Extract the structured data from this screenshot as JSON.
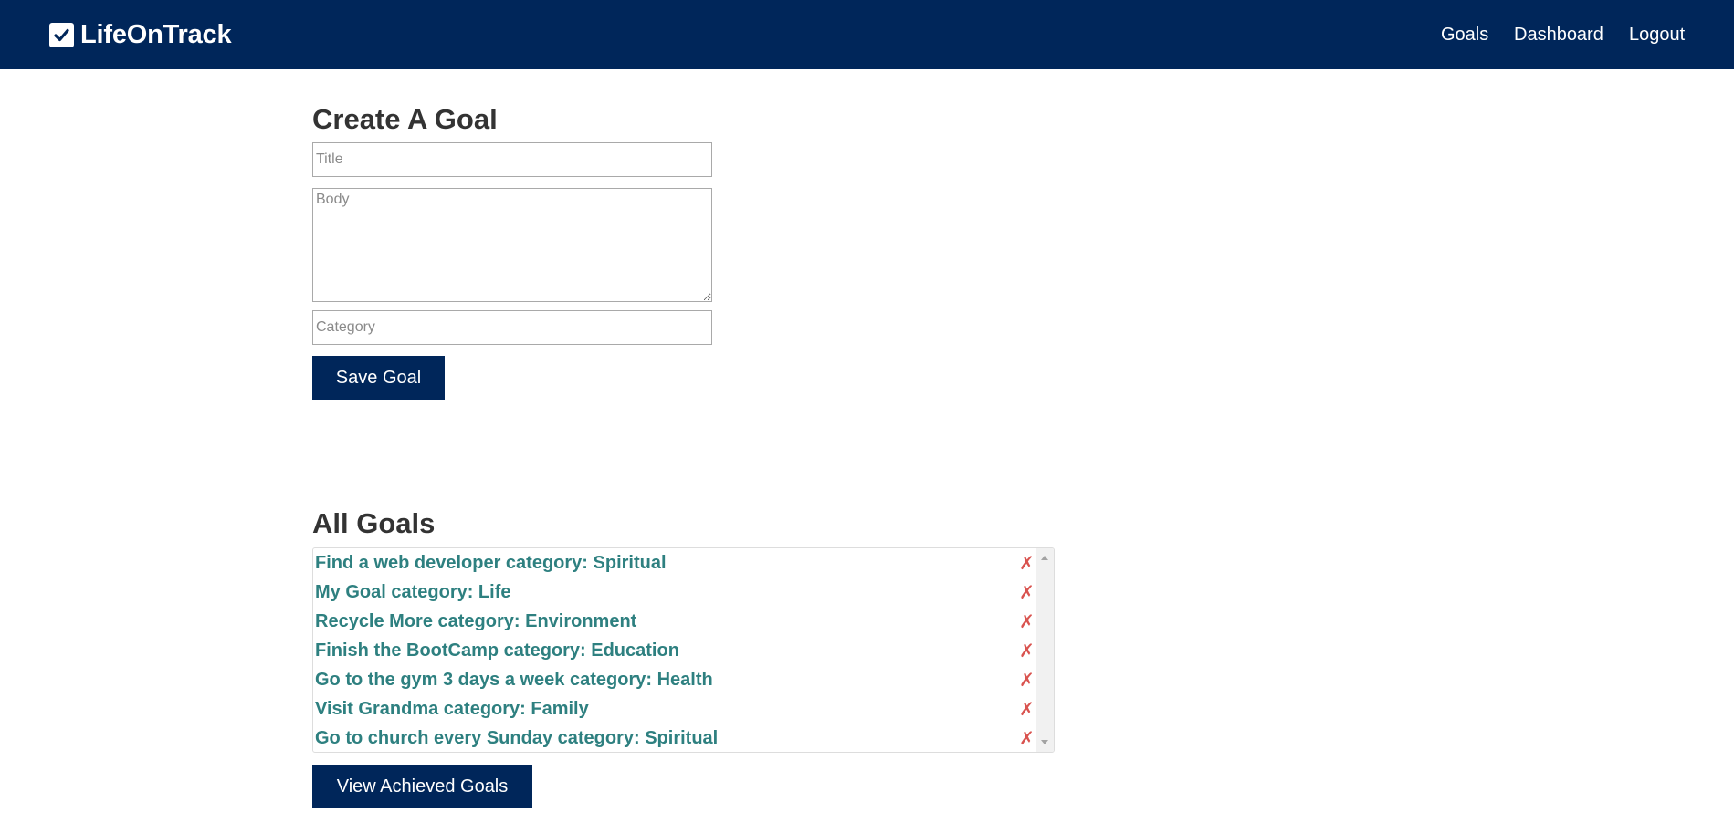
{
  "navbar": {
    "brand": "LifeOnTrack",
    "brand_icon": "checkbox-icon",
    "links": [
      "Goals",
      "Dashboard",
      "Logout"
    ]
  },
  "create": {
    "heading": "Create A Goal",
    "title_placeholder": "Title",
    "body_placeholder": "Body",
    "category_placeholder": "Category",
    "save_label": "Save Goal"
  },
  "all_goals": {
    "heading": "All Goals",
    "delete_glyph": "✗",
    "items": [
      "Find a web developer category: Spiritual",
      "My Goal category: Life",
      "Recycle More category: Environment",
      "Finish the BootCamp category: Education",
      "Go to the gym 3 days a week category: Health",
      "Visit Grandma category: Family",
      "Go to church every Sunday category: Spiritual"
    ],
    "view_achieved_label": "View Achieved Goals"
  },
  "colors": {
    "navbar": "#00265a",
    "goal_text": "#2e8080",
    "delete": "#d9534f"
  }
}
